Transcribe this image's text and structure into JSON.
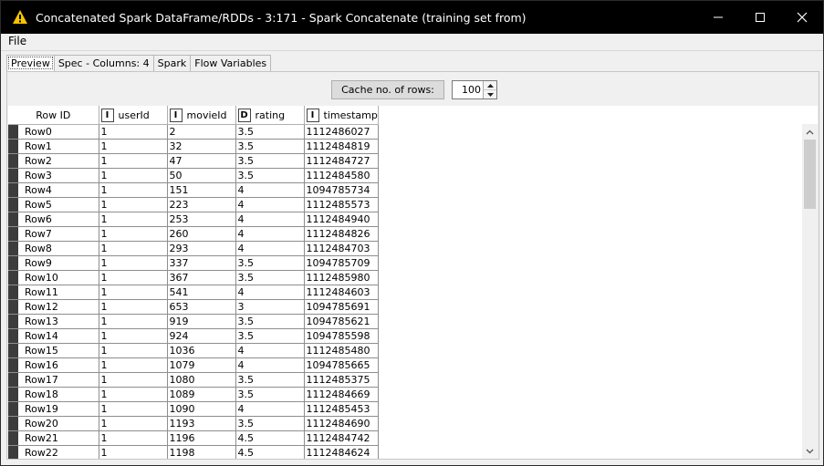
{
  "window": {
    "title": "Concatenated Spark DataFrame/RDDs - 3:171 - Spark Concatenate (training set from)",
    "accent_icon_color": "#f5c400"
  },
  "menu": {
    "file": "File"
  },
  "tabs": [
    "Preview",
    "Spec - Columns: 4",
    "Spark",
    "Flow Variables"
  ],
  "controls": {
    "cache_button": "Cache no. of rows:",
    "cache_value": "100"
  },
  "table": {
    "columns": [
      {
        "type": "",
        "name": "Row ID"
      },
      {
        "type": "I",
        "name": "userId"
      },
      {
        "type": "I",
        "name": "movieId"
      },
      {
        "type": "D",
        "name": "rating"
      },
      {
        "type": "I",
        "name": "timestamp"
      }
    ],
    "rows": [
      [
        "Row0",
        "1",
        "2",
        "3.5",
        "1112486027"
      ],
      [
        "Row1",
        "1",
        "32",
        "3.5",
        "1112484819"
      ],
      [
        "Row2",
        "1",
        "47",
        "3.5",
        "1112484727"
      ],
      [
        "Row3",
        "1",
        "50",
        "3.5",
        "1112484580"
      ],
      [
        "Row4",
        "1",
        "151",
        "4",
        "1094785734"
      ],
      [
        "Row5",
        "1",
        "223",
        "4",
        "1112485573"
      ],
      [
        "Row6",
        "1",
        "253",
        "4",
        "1112484940"
      ],
      [
        "Row7",
        "1",
        "260",
        "4",
        "1112484826"
      ],
      [
        "Row8",
        "1",
        "293",
        "4",
        "1112484703"
      ],
      [
        "Row9",
        "1",
        "337",
        "3.5",
        "1094785709"
      ],
      [
        "Row10",
        "1",
        "367",
        "3.5",
        "1112485980"
      ],
      [
        "Row11",
        "1",
        "541",
        "4",
        "1112484603"
      ],
      [
        "Row12",
        "1",
        "653",
        "3",
        "1094785691"
      ],
      [
        "Row13",
        "1",
        "919",
        "3.5",
        "1094785621"
      ],
      [
        "Row14",
        "1",
        "924",
        "3.5",
        "1094785598"
      ],
      [
        "Row15",
        "1",
        "1036",
        "4",
        "1112485480"
      ],
      [
        "Row16",
        "1",
        "1079",
        "4",
        "1094785665"
      ],
      [
        "Row17",
        "1",
        "1080",
        "3.5",
        "1112485375"
      ],
      [
        "Row18",
        "1",
        "1089",
        "3.5",
        "1112484669"
      ],
      [
        "Row19",
        "1",
        "1090",
        "4",
        "1112485453"
      ],
      [
        "Row20",
        "1",
        "1193",
        "3.5",
        "1112484690"
      ],
      [
        "Row21",
        "1",
        "1196",
        "4.5",
        "1112484742"
      ],
      [
        "Row22",
        "1",
        "1198",
        "4.5",
        "1112484624"
      ]
    ]
  }
}
